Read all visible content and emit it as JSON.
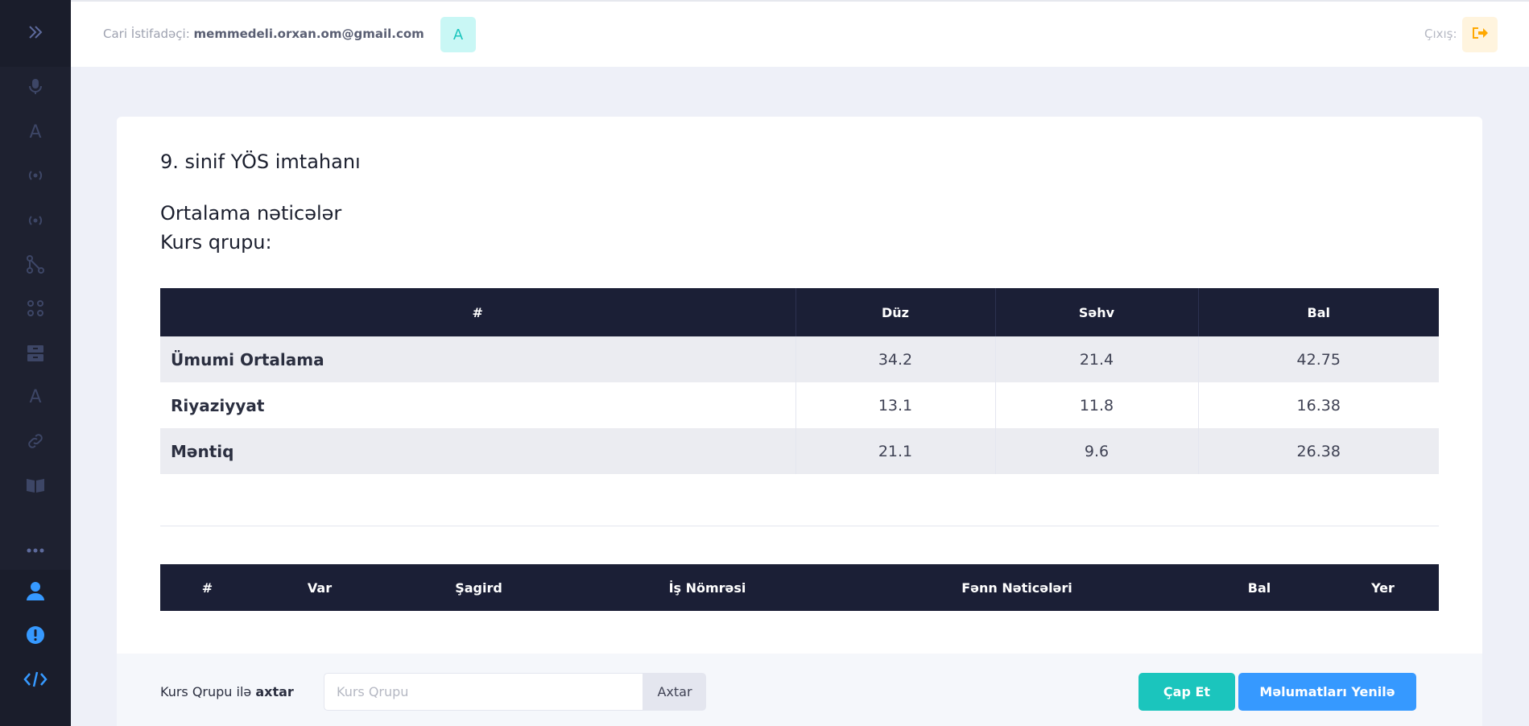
{
  "header": {
    "user_prefix": "Cari İstifadəçi:",
    "user_email": "memmedeli.orxan.om@gmail.com",
    "avatar_letter": "A",
    "logout_label": "Çıxış:"
  },
  "sidebar": {
    "icons": [
      "chevrons-right-icon",
      "microphone-icon",
      "font-a-icon",
      "broadcast-icon",
      "broadcast-icon-2",
      "nodes-icon",
      "grid-dots-icon",
      "archive-icon",
      "font-a-icon-2",
      "link-icon",
      "book-icon",
      "more-dots-icon",
      "user-icon",
      "alert-icon",
      "code-icon"
    ],
    "items": [
      {
        "label": "A"
      },
      {
        "label": "A"
      }
    ]
  },
  "exam": {
    "title": "9. sinif YÖS imtahanı",
    "averages_title": "Ortalama nəticələr",
    "group_title": "Kurs qrupu:"
  },
  "averages_table": {
    "headers": [
      "#",
      "Düz",
      "Səhv",
      "Bal"
    ],
    "rows": [
      {
        "name": "Ümumi Ortalama",
        "duz": "34.2",
        "sehv": "21.4",
        "bal": "42.75"
      },
      {
        "name": "Riyaziyyat",
        "duz": "13.1",
        "sehv": "11.8",
        "bal": "16.38"
      },
      {
        "name": "Məntiq",
        "duz": "21.1",
        "sehv": "9.6",
        "bal": "26.38"
      }
    ]
  },
  "results_table": {
    "headers": [
      "#",
      "Var",
      "Şagird",
      "İş Nömrəsi",
      "Fənn Nəticələri",
      "Bal",
      "Yer"
    ]
  },
  "footer": {
    "search_label_prefix": "Kurs Qrupu ilə",
    "search_label_bold": "axtar",
    "search_placeholder": "Kurs Qrupu",
    "search_button": "Axtar",
    "print_button": "Çap Et",
    "refresh_button": "Məlumatları Yenilə"
  },
  "colors": {
    "sidebar_bg": "#1e2130",
    "table_header_bg": "#1b1f36",
    "accent_teal": "#1bc5bd",
    "accent_blue": "#3699ff",
    "page_bg": "#eef0f8"
  }
}
